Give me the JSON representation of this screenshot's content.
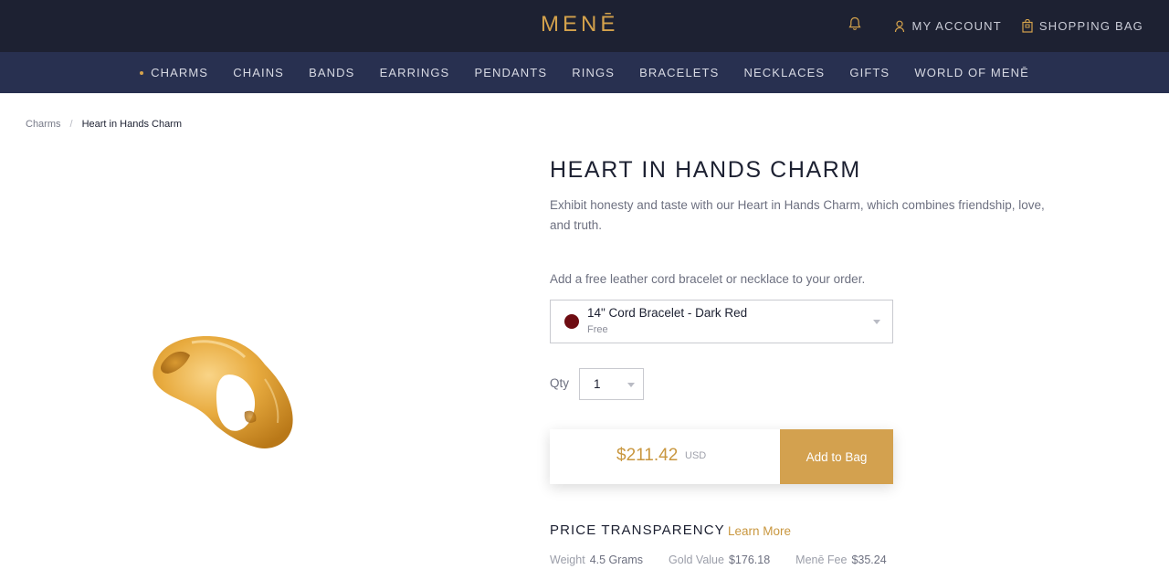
{
  "header": {
    "logo": "MENĒ",
    "bell_icon": "bell-icon",
    "account_label": "MY ACCOUNT",
    "bag_label": "SHOPPING BAG",
    "colors": {
      "bar": "#1d2132",
      "accent": "#d4a24c"
    }
  },
  "nav": {
    "items": [
      {
        "label": "CHARMS",
        "active": true
      },
      {
        "label": "CHAINS"
      },
      {
        "label": "BANDS"
      },
      {
        "label": "EARRINGS"
      },
      {
        "label": "PENDANTS"
      },
      {
        "label": "RINGS"
      },
      {
        "label": "BRACELETS"
      },
      {
        "label": "NECKLACES"
      },
      {
        "label": "GIFTS"
      },
      {
        "label": "WORLD OF MENĒ"
      }
    ]
  },
  "breadcrumb": {
    "parent": "Charms",
    "separator": "/",
    "current": "Heart in Hands Charm"
  },
  "product": {
    "title": "HEART IN HANDS CHARM",
    "description": "Exhibit honesty and taste with our Heart in Hands Charm, which combines friendship, love, and truth.",
    "offer_label": "Add a free leather cord bracelet or necklace to your order.",
    "cord": {
      "name": "14\" Cord Bracelet - Dark Red",
      "price": "Free",
      "swatch_color": "#6e0c12"
    },
    "qty_label": "Qty",
    "qty_value": "1",
    "price": "$211.42",
    "currency": "USD",
    "add_button": "Add to Bag"
  },
  "price_transparency": {
    "title": "PRICE TRANSPARENCY",
    "learn_more": "Learn More",
    "weight_label": "Weight",
    "weight_value": "4.5 Grams",
    "gold_label": "Gold Value",
    "gold_value": "$176.18",
    "fee_label": "Menē Fee",
    "fee_value": "$35.24"
  }
}
